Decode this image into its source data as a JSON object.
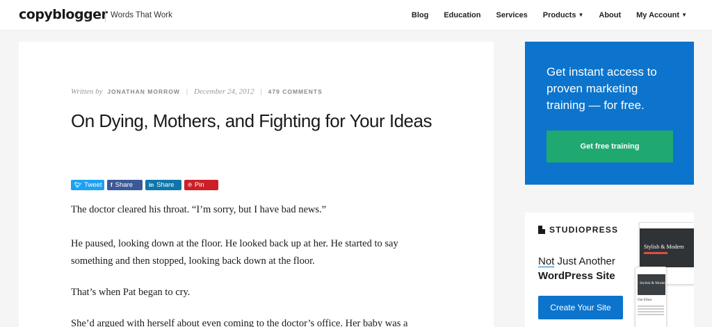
{
  "header": {
    "logo": "copyblogger",
    "tagline": "Words That Work",
    "nav": [
      {
        "label": "Blog",
        "dropdown": false
      },
      {
        "label": "Education",
        "dropdown": false
      },
      {
        "label": "Services",
        "dropdown": false
      },
      {
        "label": "Products",
        "dropdown": true
      },
      {
        "label": "About",
        "dropdown": false
      },
      {
        "label": "My Account",
        "dropdown": true
      }
    ]
  },
  "article": {
    "written_by": "Written by",
    "author": "Jonathan Morrow",
    "date": "December 24, 2012",
    "comments": "479 Comments",
    "title": "On Dying, Mothers, and Fighting for Your Ideas",
    "share": [
      {
        "label": "Tweet",
        "icon": "twitter-icon",
        "color": "#1da1f2"
      },
      {
        "label": "Share",
        "icon": "facebook-icon",
        "color": "#3b5998"
      },
      {
        "label": "Share",
        "icon": "linkedin-icon",
        "color": "#0e76a8"
      },
      {
        "label": "Pin",
        "icon": "pinterest-icon",
        "color": "#cb2027"
      }
    ],
    "paragraphs": [
      "The doctor cleared his throat. “I’m sorry, but I have bad news.”",
      "He paused, looking down at the floor. He looked back up at her. He started to say something and then stopped, looking back down at the floor.",
      "That’s when Pat began to cry.",
      "She’d argued with herself about even coming to the doctor’s office. Her baby was a"
    ]
  },
  "sidebar": {
    "promo": {
      "text": "Get instant access to proven marketing training — for free.",
      "button": "Get free training",
      "bg_color": "#0c74cc",
      "button_color": "#1fa971"
    },
    "studiopress": {
      "logo": "STUDIOPRESS",
      "headline_underlined": "Not",
      "headline_rest": " Just Another",
      "headline_bold": "WordPress Site",
      "button": "Create Your Site",
      "mock_title_large": "Stylish & Modern",
      "mock_title_small": "Stylish & Modern",
      "mock_sub": "Our Ethos"
    }
  }
}
